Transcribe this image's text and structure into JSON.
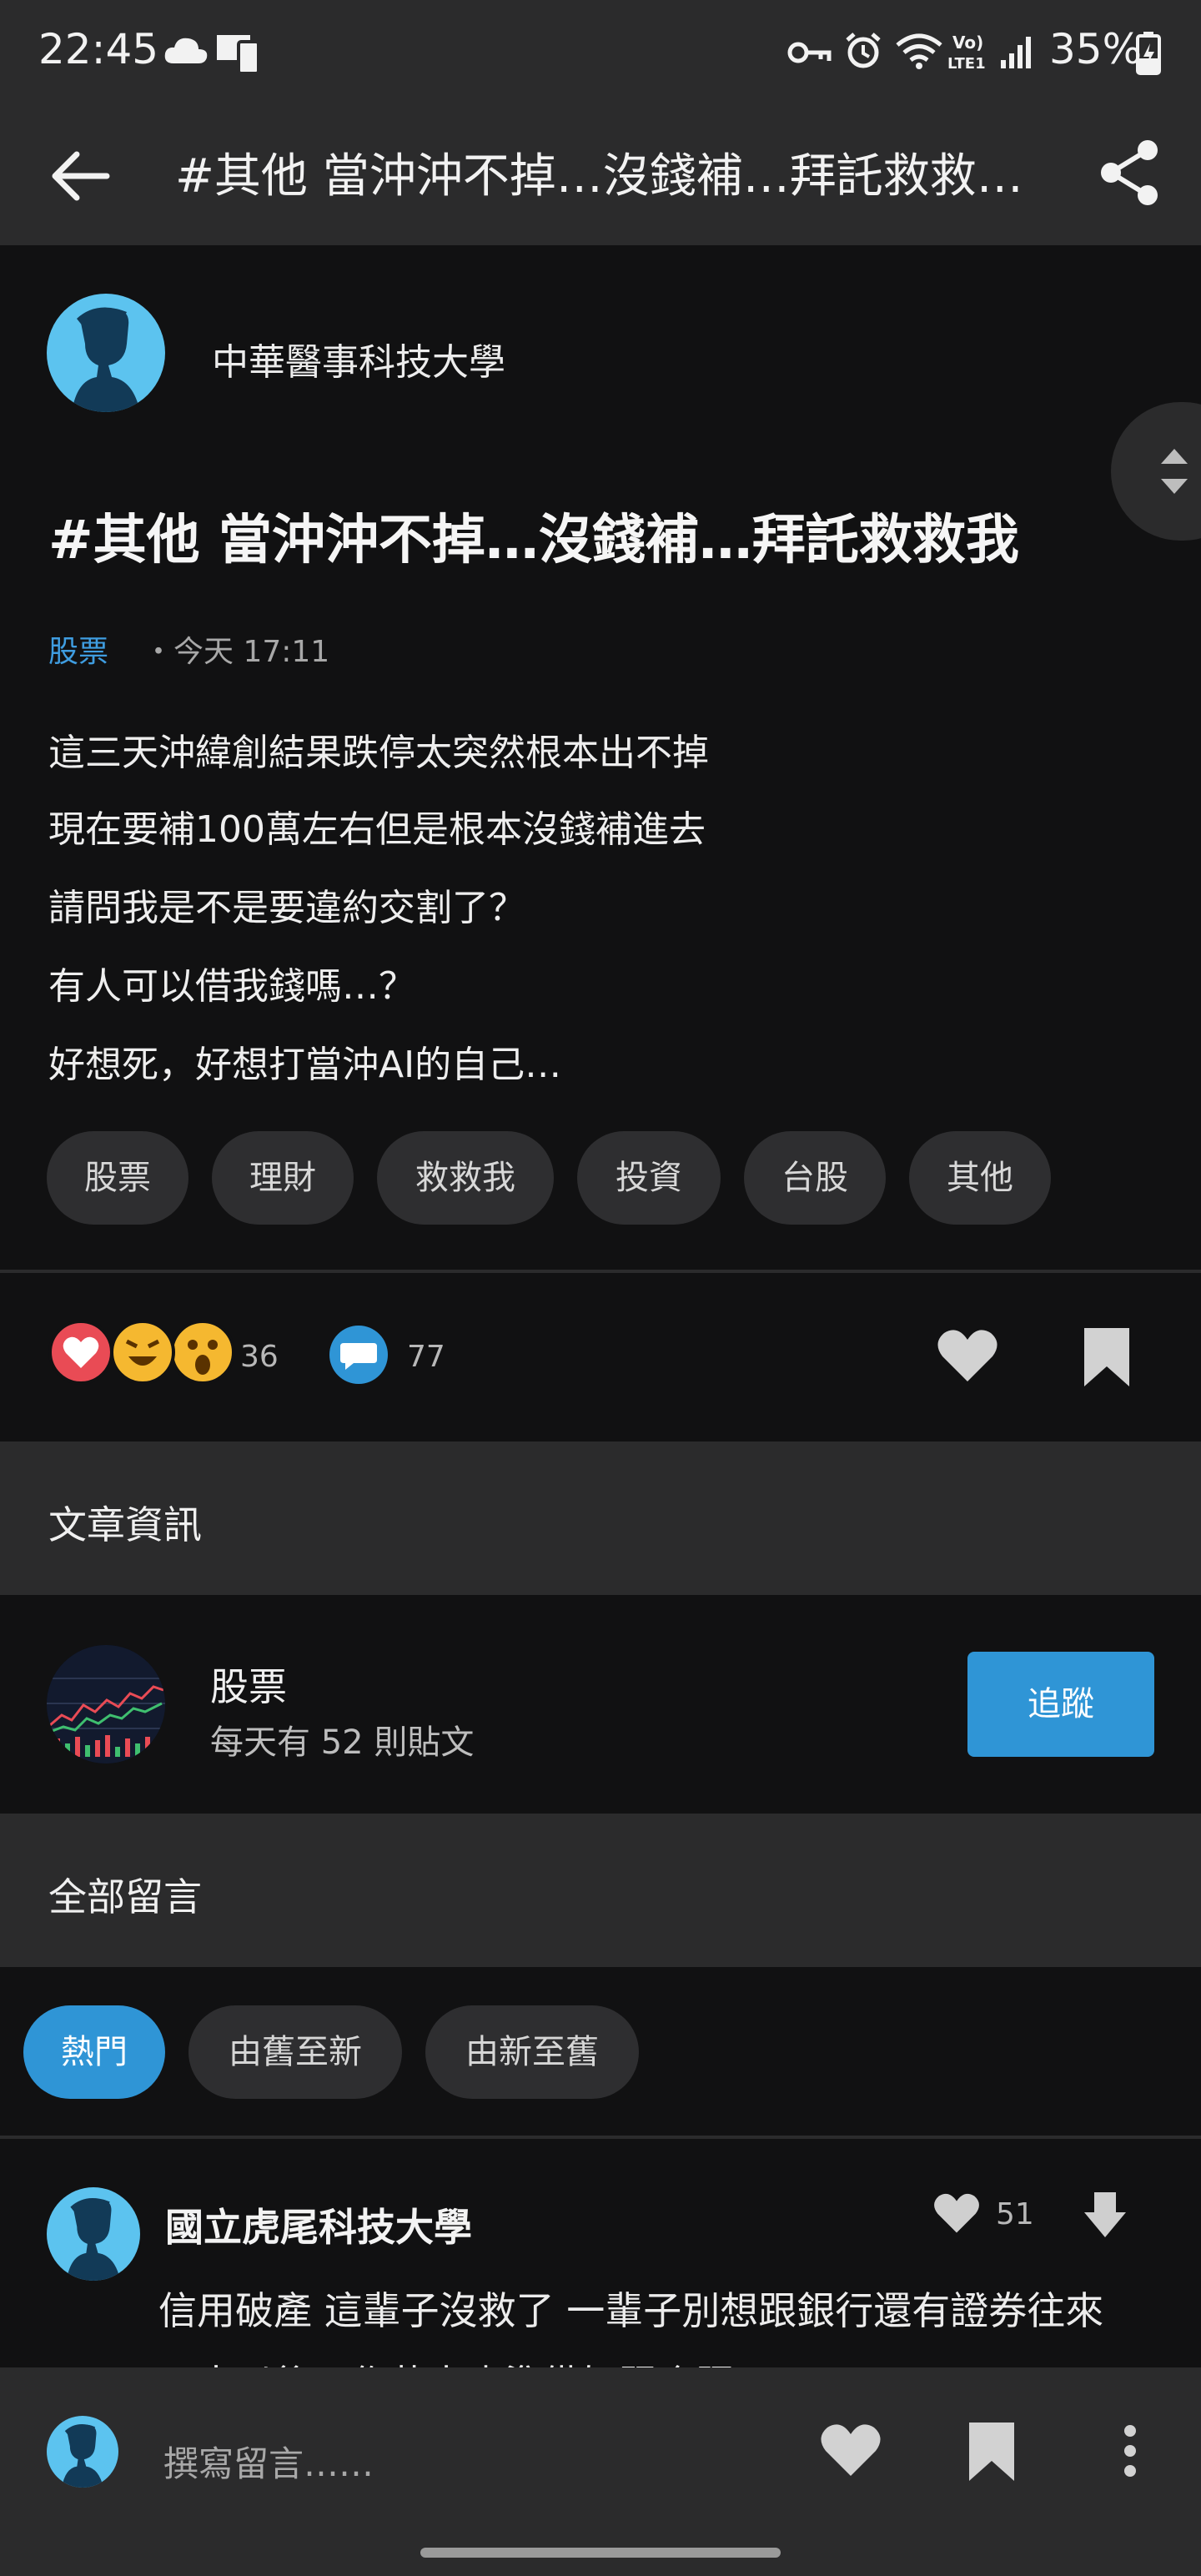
{
  "status_bar": {
    "time": "22:45",
    "battery": "35%"
  },
  "header": {
    "title": "#其他 當沖沖不掉…沒錢補…拜託救救…"
  },
  "post": {
    "author": "中華醫事科技大學",
    "title": "#其他 當沖沖不掉…沒錢補…拜託救救我",
    "board": "股票",
    "time": "・今天 17:11",
    "body": [
      "這三天沖緯創結果跌停太突然根本出不掉",
      "現在要補100萬左右但是根本沒錢補進去",
      "請問我是不是要違約交割了？",
      "有人可以借我錢嗎…？",
      "好想死，好想打當沖AI的自己…"
    ],
    "tags": [
      "股票",
      "理財",
      "救救我",
      "投資",
      "台股",
      "其他"
    ],
    "reaction_count": "36",
    "comment_count": "77"
  },
  "article_info": {
    "heading": "文章資訊",
    "board_name": "股票",
    "board_stats": "每天有 52 則貼文",
    "follow_label": "追蹤"
  },
  "comments": {
    "heading": "全部留言",
    "sort_options": [
      "熱門",
      "由舊至新",
      "由新至舊"
    ],
    "active_sort": "熱門",
    "first": {
      "author": "國立虎尾科技大學",
      "likes": "51",
      "text": "信用破產 這輩子沒救了 一輩子別想跟銀行還有證券往來",
      "text_partial": "三十以後工作薪水也準備好跟合照"
    }
  },
  "composer": {
    "placeholder": "撰寫留言……"
  },
  "colors": {
    "accent": "#2f95d6",
    "avatar": "#5cc3ef",
    "background": "#111112",
    "surface": "#2b2b2c"
  }
}
